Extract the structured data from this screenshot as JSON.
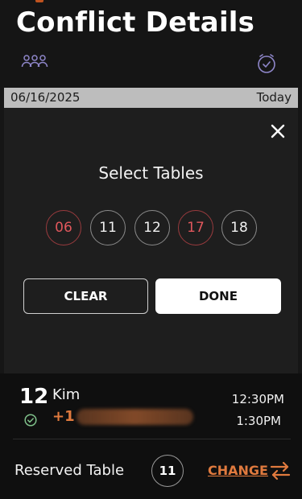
{
  "header": {
    "title": "Conflict Details",
    "icons": {
      "left": "people-group-icon",
      "right": "clock-check-icon"
    }
  },
  "date_bar": {
    "date": "06/16/2025",
    "relative": "Today"
  },
  "modal": {
    "title": "Select Tables",
    "close_icon": "close-icon",
    "tables": [
      {
        "label": "06",
        "status": "conflict"
      },
      {
        "label": "11",
        "status": "available"
      },
      {
        "label": "12",
        "status": "available"
      },
      {
        "label": "17",
        "status": "conflict"
      },
      {
        "label": "18",
        "status": "available"
      }
    ],
    "clear_label": "CLEAR",
    "done_label": "DONE"
  },
  "reservation": {
    "table_number": "12",
    "guest_name": "Kim",
    "phone_prefix": "+1",
    "time_start": "12:30PM",
    "time_end": "1:30PM",
    "reserved_label": "Reserved Table",
    "reserved_table": "11",
    "change_label": "CHANGE"
  },
  "colors": {
    "accent": "#e07a3e",
    "conflict": "#e0575c",
    "background": "#161616"
  }
}
